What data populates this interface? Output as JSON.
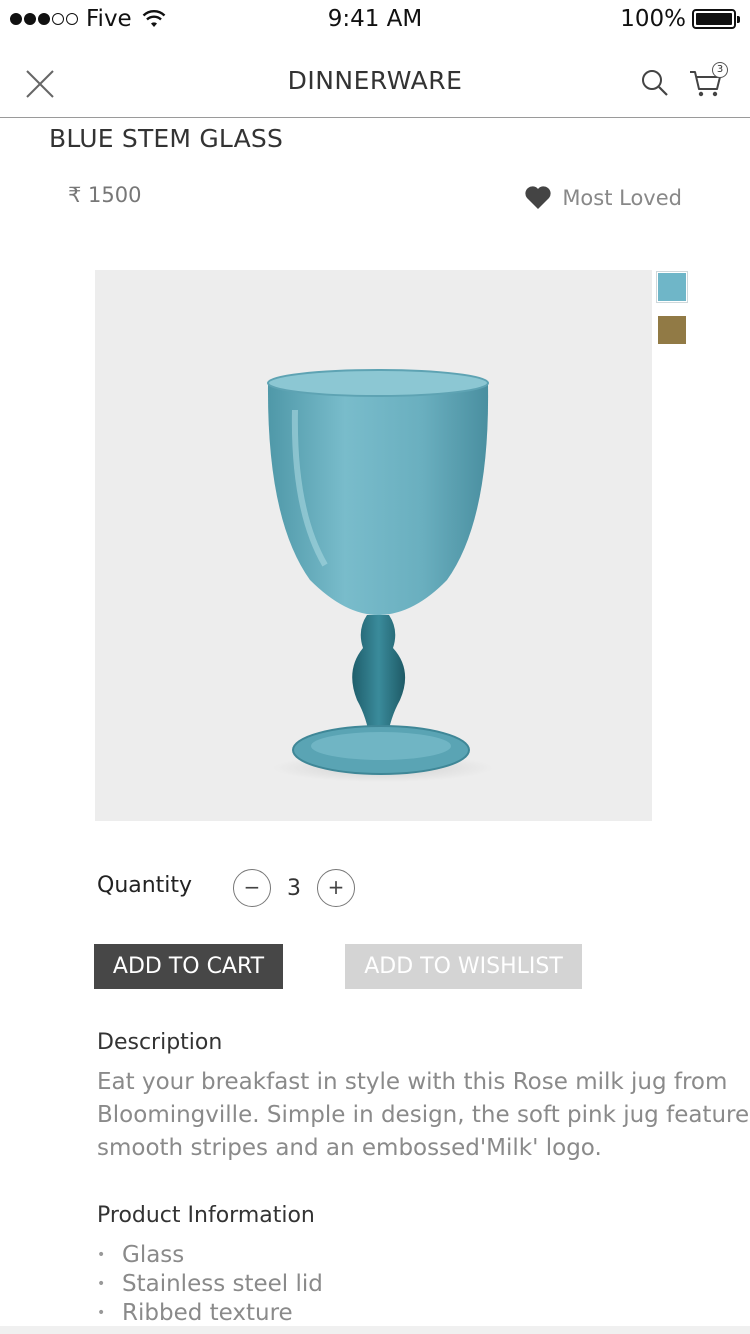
{
  "status_bar": {
    "carrier": "Five",
    "time": "9:41 AM",
    "battery": "100%"
  },
  "header": {
    "title": "DINNERWARE",
    "cart_count": "3"
  },
  "product": {
    "title": "BLUE STEM GLASS",
    "price": "₹ 1500",
    "most_loved_label": "Most Loved",
    "swatches": [
      {
        "name": "blue",
        "color": "#6fb6c8"
      },
      {
        "name": "gold",
        "color": "#917a45"
      }
    ],
    "image_subject": "blue-stem-glass"
  },
  "quantity": {
    "label": "Quantity",
    "minus": "−",
    "value": "3",
    "plus": "+"
  },
  "actions": {
    "add_to_cart": "ADD TO CART",
    "add_to_wishlist": "ADD TO WISHLIST"
  },
  "description": {
    "title": "Description",
    "lines": [
      "Eat your breakfast in style with this Rose milk jug from",
      "Bloomingville. Simple in design, the soft pink jug features",
      "smooth stripes and an embossed'Milk' logo."
    ]
  },
  "product_info": {
    "title": "Product Information",
    "items": [
      "Glass",
      "Stainless steel lid",
      "Ribbed texture"
    ]
  },
  "colors": {
    "dark_button": "#474747",
    "light_button": "#d4d4d4",
    "muted_text": "#8a8a8a"
  }
}
